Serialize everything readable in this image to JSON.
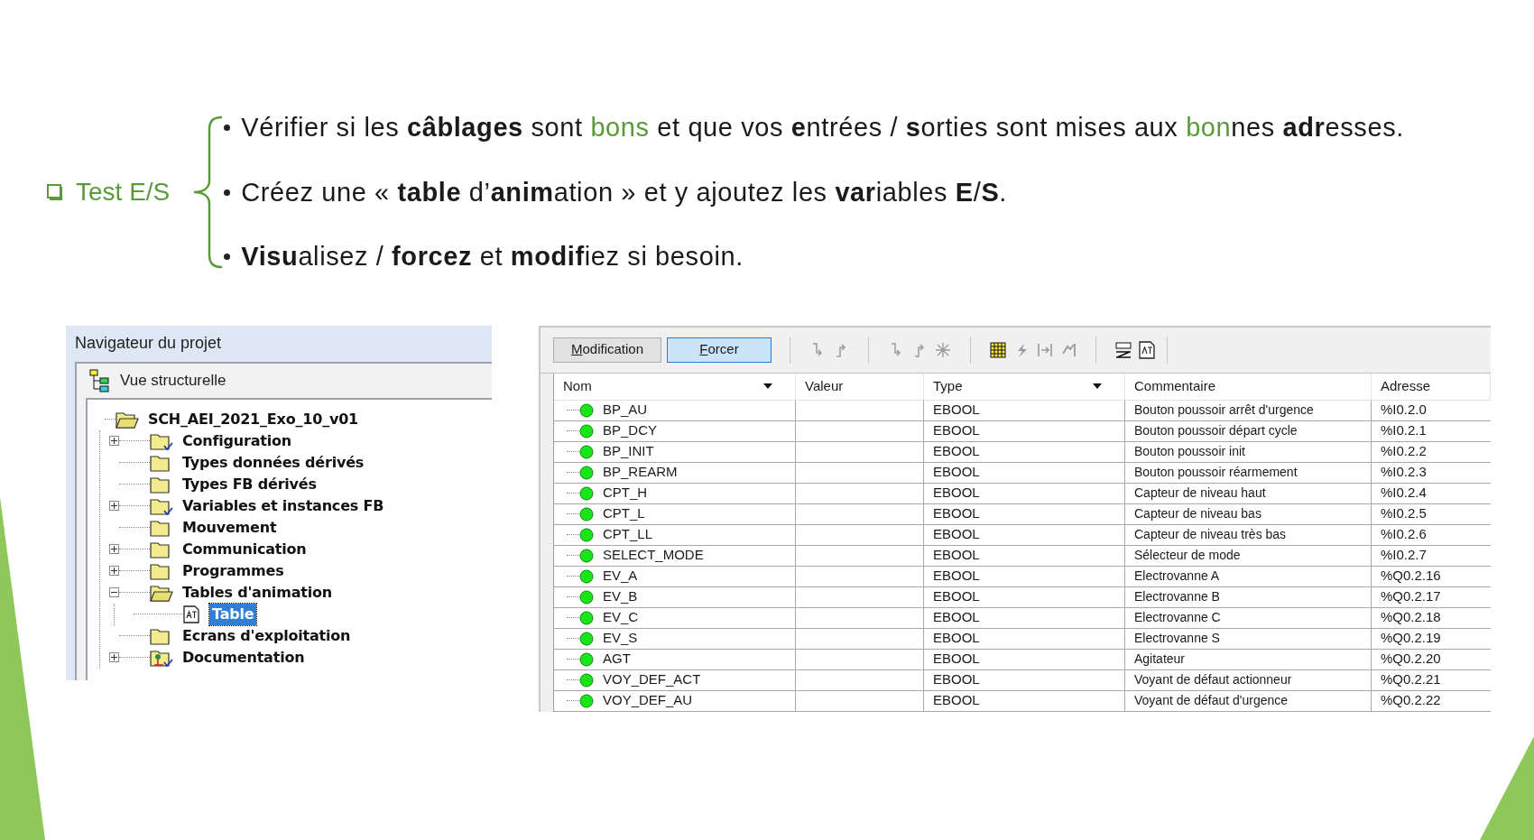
{
  "heading": {
    "label": "Test E/S"
  },
  "bullets": [
    {
      "segments": [
        {
          "kind": "plain",
          "text": "Vérifier si les "
        },
        {
          "kind": "bold",
          "text": "câblages"
        },
        {
          "kind": "plain",
          "text": " sont "
        },
        {
          "kind": "accent",
          "text": "bons"
        },
        {
          "kind": "plain",
          "text": " et que vos "
        },
        {
          "kind": "bold",
          "text": "e"
        },
        {
          "kind": "plain",
          "text": "ntrées / "
        },
        {
          "kind": "bold",
          "text": "s"
        },
        {
          "kind": "plain",
          "text": "orties sont mises aux "
        },
        {
          "kind": "accent",
          "text": "bon"
        },
        {
          "kind": "plain",
          "text": "nes "
        },
        {
          "kind": "bold",
          "text": "adr"
        },
        {
          "kind": "plain",
          "text": "esses."
        }
      ]
    },
    {
      "segments": [
        {
          "kind": "plain",
          "text": "Créez une « "
        },
        {
          "kind": "bold",
          "text": "table"
        },
        {
          "kind": "plain",
          "text": " d’"
        },
        {
          "kind": "bold",
          "text": "anim"
        },
        {
          "kind": "plain",
          "text": "ation » et y ajoutez les "
        },
        {
          "kind": "bold",
          "text": "var"
        },
        {
          "kind": "plain",
          "text": "iables "
        },
        {
          "kind": "bold",
          "text": "E"
        },
        {
          "kind": "plain",
          "text": "/"
        },
        {
          "kind": "bold",
          "text": "S"
        },
        {
          "kind": "plain",
          "text": "."
        }
      ]
    },
    {
      "segments": [
        {
          "kind": "bold",
          "text": "Visu"
        },
        {
          "kind": "plain",
          "text": "alisez / "
        },
        {
          "kind": "bold",
          "text": "forcez"
        },
        {
          "kind": "plain",
          "text": " et "
        },
        {
          "kind": "bold",
          "text": "modif"
        },
        {
          "kind": "plain",
          "text": "iez si besoin."
        }
      ]
    }
  ],
  "project_browser": {
    "title": "Navigateur du projet",
    "view": "Vue structurelle",
    "tree": [
      {
        "label": "SCH_AEI_2021_Exo_10_v01",
        "kind": "folder",
        "expandable": false,
        "expanded": true,
        "selected": false,
        "children": [
          {
            "label": "Configuration",
            "kind": "folder-checked",
            "expandable": true,
            "expanded": false,
            "selected": false
          },
          {
            "label": "Types données dérivés",
            "kind": "folder",
            "expandable": false,
            "expanded": false,
            "selected": false
          },
          {
            "label": "Types FB dérivés",
            "kind": "folder",
            "expandable": false,
            "expanded": false,
            "selected": false
          },
          {
            "label": "Variables et instances FB",
            "kind": "folder-checked",
            "expandable": true,
            "expanded": false,
            "selected": false
          },
          {
            "label": "Mouvement",
            "kind": "folder",
            "expandable": false,
            "expanded": false,
            "selected": false
          },
          {
            "label": "Communication",
            "kind": "folder",
            "expandable": true,
            "expanded": false,
            "selected": false
          },
          {
            "label": "Programmes",
            "kind": "folder",
            "expandable": true,
            "expanded": false,
            "selected": false
          },
          {
            "label": "Tables d'animation",
            "kind": "folder",
            "expandable": true,
            "expanded": true,
            "selected": false,
            "children": [
              {
                "label": "Table",
                "kind": "table",
                "expandable": false,
                "expanded": false,
                "selected": true
              }
            ]
          },
          {
            "label": "Ecrans d'exploitation",
            "kind": "folder",
            "expandable": false,
            "expanded": false,
            "selected": false
          },
          {
            "label": "Documentation",
            "kind": "documentation",
            "expandable": true,
            "expanded": false,
            "selected": false
          }
        ]
      }
    ]
  },
  "animation_table": {
    "modes": [
      {
        "label": "Modification",
        "selected": false
      },
      {
        "label": "Forcer",
        "selected": true
      }
    ],
    "columns": [
      {
        "label": "Nom",
        "sortable": true
      },
      {
        "label": "Valeur",
        "sortable": false
      },
      {
        "label": "Type",
        "sortable": true
      },
      {
        "label": "Commentaire",
        "sortable": false
      },
      {
        "label": "Adresse",
        "sortable": false
      }
    ],
    "rows": [
      {
        "name": "BP_AU",
        "type": "EBOOL",
        "comment": "Bouton poussoir arrêt d'urgence",
        "address": "%I0.2.0"
      },
      {
        "name": "BP_DCY",
        "type": "EBOOL",
        "comment": "Bouton poussoir départ cycle",
        "address": "%I0.2.1"
      },
      {
        "name": "BP_INIT",
        "type": "EBOOL",
        "comment": "Bouton poussoir init",
        "address": "%I0.2.2"
      },
      {
        "name": "BP_REARM",
        "type": "EBOOL",
        "comment": "Bouton poussoir réarmement",
        "address": "%I0.2.3"
      },
      {
        "name": "CPT_H",
        "type": "EBOOL",
        "comment": "Capteur de niveau haut",
        "address": "%I0.2.4"
      },
      {
        "name": "CPT_L",
        "type": "EBOOL",
        "comment": "Capteur de niveau bas",
        "address": "%I0.2.5"
      },
      {
        "name": "CPT_LL",
        "type": "EBOOL",
        "comment": "Capteur de niveau très bas",
        "address": "%I0.2.6"
      },
      {
        "name": "SELECT_MODE",
        "type": "EBOOL",
        "comment": "Sélecteur de mode",
        "address": "%I0.2.7"
      },
      {
        "name": "EV_A",
        "type": "EBOOL",
        "comment": "Electrovanne A",
        "address": "%Q0.2.16"
      },
      {
        "name": "EV_B",
        "type": "EBOOL",
        "comment": "Electrovanne B",
        "address": "%Q0.2.17"
      },
      {
        "name": "EV_C",
        "type": "EBOOL",
        "comment": "Electrovanne C",
        "address": "%Q0.2.18"
      },
      {
        "name": "EV_S",
        "type": "EBOOL",
        "comment": "Electrovanne S",
        "address": "%Q0.2.19"
      },
      {
        "name": "AGT",
        "type": "EBOOL",
        "comment": "Agitateur",
        "address": "%Q0.2.20"
      },
      {
        "name": "VOY_DEF_ACT",
        "type": "EBOOL",
        "comment": "Voyant de défaut actionneur",
        "address": "%Q0.2.21"
      },
      {
        "name": "VOY_DEF_AU",
        "type": "EBOOL",
        "comment": "Voyant de défaut d'urgence",
        "address": "%Q0.2.22"
      }
    ]
  }
}
